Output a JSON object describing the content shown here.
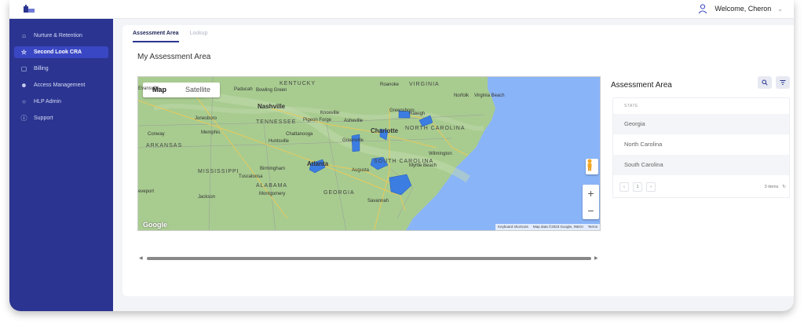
{
  "header": {
    "welcome": "Welcome, Cheron"
  },
  "sidebar": {
    "items": [
      {
        "label": "Nurture & Retention",
        "icon": "bank-icon"
      },
      {
        "label": "Second Look CRA",
        "icon": "star-icon",
        "active": true
      },
      {
        "label": "Billing",
        "icon": "document-icon"
      },
      {
        "label": "Access Management",
        "icon": "users-icon"
      },
      {
        "label": "HLP Admin",
        "icon": "dot-icon"
      },
      {
        "label": "Support",
        "icon": "help-icon"
      }
    ]
  },
  "main": {
    "tabs": [
      {
        "label": "Assessment Area",
        "active": true
      },
      {
        "label": "Lookup",
        "active": false
      }
    ],
    "page_title": "My Assessment Area"
  },
  "map": {
    "toggle": {
      "map": "Map",
      "satellite": "Satellite"
    },
    "labels": {
      "kentucky": "KENTUCKY",
      "virginia": "VIRGINIA",
      "tennessee": "TENNESSEE",
      "arkansas": "ARKANSAS",
      "north_carolina": "NORTH CAROLINA",
      "south_carolina": "SOUTH CAROLINA",
      "mississippi": "MISSISSIPPI",
      "alabama": "ALABAMA",
      "georgia": "GEORGIA",
      "nashville": "Nashville",
      "knoxville": "Knoxville",
      "charlotte": "Charlotte",
      "atlanta": "Atlanta",
      "memphis": "Memphis",
      "birmingham": "Birmingham",
      "chattanooga": "Chattanooga",
      "huntsville": "Huntsville",
      "greensboro": "Greensboro",
      "raleigh": "Raleigh",
      "wilmington": "Wilmington",
      "augusta": "Augusta",
      "savannah": "Savannah",
      "montgomery": "Montgomery",
      "jackson": "Jackson",
      "tuscaloosa": "Tuscaloosa",
      "jonesboro": "Jonesboro",
      "conway": "Conway",
      "paducah": "Paducah",
      "bowling_green": "Bowling Green",
      "roanoke": "Roanoke",
      "norfolk": "Norfolk",
      "virginia_beach": "Virginia Beach",
      "myrtle_beach": "Myrtle Beach",
      "asheville": "Asheville",
      "pigeon_forge": "Pigeon Forge",
      "greenville": "Greenville",
      "evansville": "Evansville",
      "shreveport": "eveport"
    },
    "footer": {
      "shortcuts": "Keyboard shortcuts",
      "mapdata": "Map data ©2023 Google, INEGI",
      "terms": "Terms"
    },
    "google": "Google",
    "colors": {
      "water": "#8ab4f8",
      "land": "#a5c98b",
      "highlight": "#3b7de0"
    }
  },
  "assessment_panel": {
    "title": "Assessment Area",
    "column_header": "STATE",
    "rows": [
      "Georgia",
      "North Carolina",
      "South Carolina"
    ],
    "pager": {
      "page": "1",
      "count": "3 items"
    }
  }
}
